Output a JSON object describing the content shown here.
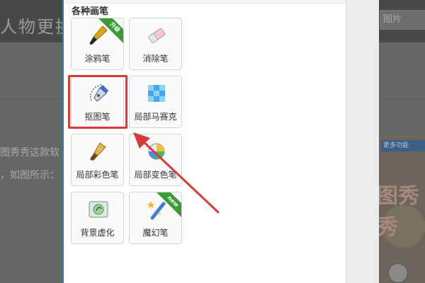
{
  "background": {
    "title": "人物更换",
    "right_tab": "图片",
    "line1": "图秀秀这款软",
    "line2": "，如图所示：",
    "promo_tab": "更多功能",
    "promo_big": "图秀秀"
  },
  "panel": {
    "section_title": "各种画笔",
    "tools": [
      {
        "label": "涂鸦笔",
        "icon": "brush-icon",
        "badge": "升级"
      },
      {
        "label": "消除笔",
        "icon": "eraser-icon",
        "badge": ""
      },
      {
        "label": "抠图笔",
        "icon": "pen-nib-icon",
        "badge": ""
      },
      {
        "label": "局部马赛克",
        "icon": "mosaic-icon",
        "badge": ""
      },
      {
        "label": "局部彩色笔",
        "icon": "color-brush-icon",
        "badge": ""
      },
      {
        "label": "局部变色笔",
        "icon": "color-change-icon",
        "badge": ""
      },
      {
        "label": "背景虚化",
        "icon": "blur-background-icon",
        "badge": ""
      },
      {
        "label": "魔幻笔",
        "icon": "magic-wand-icon",
        "badge": "new"
      }
    ],
    "selected_tool": "抠图笔"
  },
  "colors": {
    "highlight": "#d83a3a",
    "ribbon_green": "#3a9b3a",
    "accent_blue": "#3b78c6"
  }
}
